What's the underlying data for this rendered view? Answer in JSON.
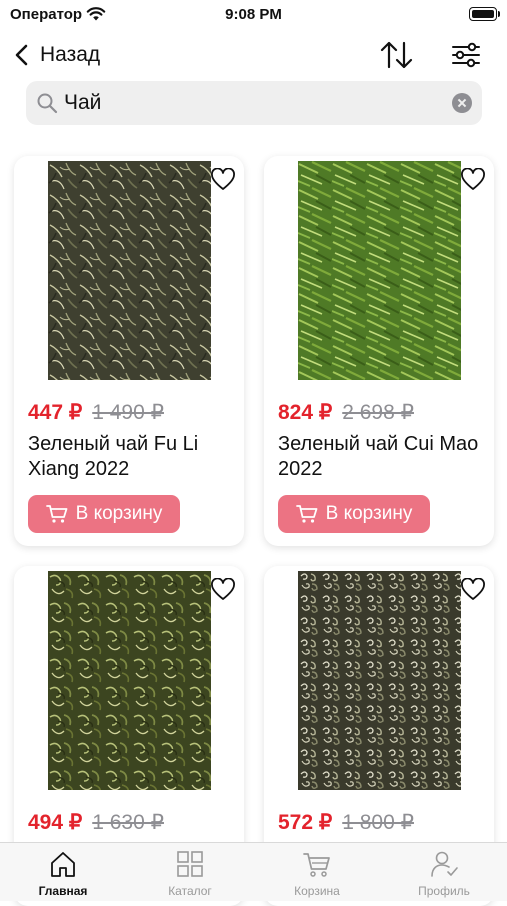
{
  "status_bar": {
    "carrier": "Оператор",
    "time": "9:08 PM"
  },
  "nav": {
    "back_label": "Назад"
  },
  "search": {
    "value": "Чай"
  },
  "products": [
    {
      "price": "447 ₽",
      "old_price": "1 490 ₽",
      "name": "Зеленый чай Fu Li Xiang 2022",
      "cart_label": "В корзину",
      "image": "tea-leaves-dark-curly"
    },
    {
      "price": "824 ₽",
      "old_price": "2 698 ₽",
      "name": "Зеленый чай Cui Mao 2022",
      "cart_label": "В корзину",
      "image": "tea-leaves-green-needles"
    },
    {
      "price": "494 ₽",
      "old_price": "1 630 ₽",
      "name": "",
      "cart_label": "",
      "image": "tea-leaves-green-curly"
    },
    {
      "price": "572 ₽",
      "old_price": "1 800 ₽",
      "name": "",
      "cart_label": "",
      "image": "tea-leaves-silver-spiral"
    }
  ],
  "tabbar": {
    "items": [
      {
        "label": "Главная",
        "icon": "home-icon",
        "active": true
      },
      {
        "label": "Каталог",
        "icon": "grid-icon",
        "active": false
      },
      {
        "label": "Корзина",
        "icon": "cart-icon",
        "active": false
      },
      {
        "label": "Профиль",
        "icon": "profile-icon",
        "active": false
      }
    ]
  },
  "colors": {
    "price": "#e3232c",
    "old_price": "#8e8e93",
    "cart_button": "#ec7383",
    "tab_inactive": "#9a9a9a"
  }
}
